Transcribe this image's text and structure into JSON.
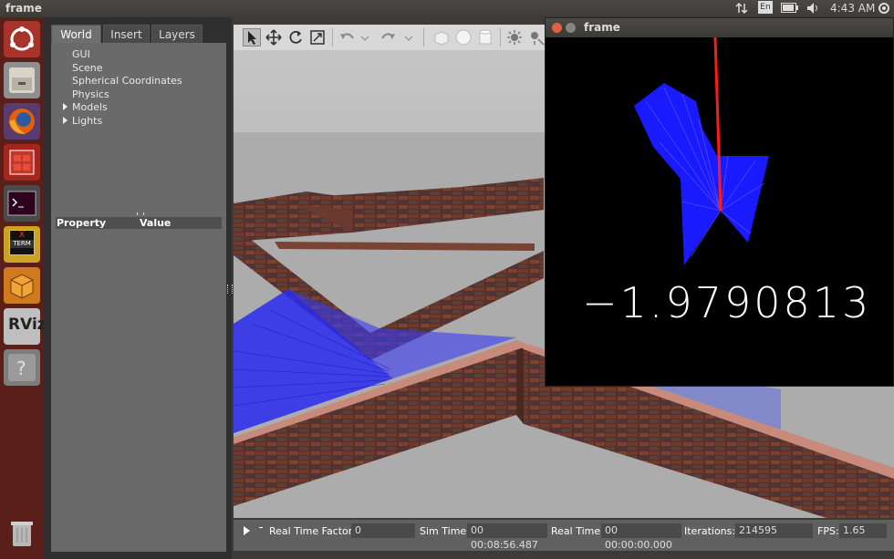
{
  "window_title": "frame",
  "topbar": {
    "keyboard": "En",
    "clock": "4:43 AM"
  },
  "launcher": {
    "items": [
      "ubuntu-dash",
      "files",
      "firefox",
      "calculator",
      "terminal",
      "xterm",
      "virtualbox",
      "rviz",
      "help",
      "trash"
    ],
    "xterm_label_top": "X",
    "xterm_label_bottom": "TERM",
    "rviz_label": "RViz"
  },
  "gazebo": {
    "tabs": [
      "World",
      "Insert",
      "Layers"
    ],
    "tree_items": [
      {
        "label": "GUI",
        "expandable": false
      },
      {
        "label": "Scene",
        "expandable": false
      },
      {
        "label": "Spherical Coordinates",
        "expandable": false
      },
      {
        "label": "Physics",
        "expandable": false
      },
      {
        "label": "Models",
        "expandable": true
      },
      {
        "label": "Lights",
        "expandable": true
      }
    ],
    "property_header": "Property",
    "value_header": "Value",
    "status": {
      "rtf_label": "Real Time Factor:",
      "rtf_value": "0",
      "sim_time_label": "Sim Time:",
      "sim_time_value": "00 00:08:56.487",
      "real_time_label": "Real Time:",
      "real_time_value": "00 00:00:00.000",
      "iterations_label": "Iterations:",
      "iterations_value": "214595",
      "fps_label": "FPS:",
      "fps_value": "1.65"
    }
  },
  "frame_window": {
    "title": "frame",
    "value": "−1.9790813"
  },
  "colors": {
    "launcher": "#5a1f18",
    "scan_blue": "#1a1aff",
    "heading_red": "#ff1a1a"
  }
}
